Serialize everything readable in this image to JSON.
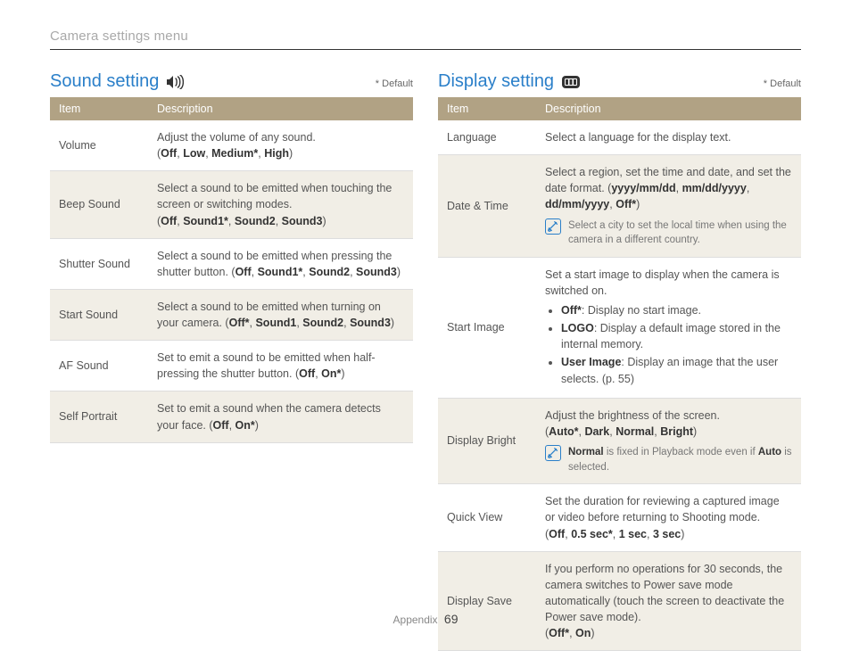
{
  "breadcrumb": "Camera settings menu",
  "default_note": "* Default",
  "sound": {
    "title": "Sound setting",
    "headers": {
      "item": "Item",
      "desc": "Description"
    },
    "rows": {
      "volume": {
        "item": "Volume",
        "desc_pre": "Adjust the volume of any sound.",
        "opts_open": "(",
        "o1": "Off",
        "c1": ", ",
        "o2": "Low",
        "c2": ", ",
        "o3": "Medium*",
        "c3": ", ",
        "o4": "High",
        "opts_close": ")"
      },
      "beep": {
        "item": "Beep Sound",
        "desc_pre": "Select a sound to be emitted when touching the screen or switching modes.",
        "opts_open": "(",
        "o1": "Off",
        "c1": ", ",
        "o2": "Sound1*",
        "c2": ", ",
        "o3": "Sound2",
        "c3": ", ",
        "o4": "Sound3",
        "opts_close": ")"
      },
      "shutter": {
        "item": "Shutter Sound",
        "desc_pre": "Select a sound to be emitted when pressing the shutter button. (",
        "o1": "Off",
        "c1": ", ",
        "o2": "Sound1*",
        "c2": ", ",
        "o3": "Sound2",
        "c3": ", ",
        "o4": "Sound3",
        "opts_close": ")"
      },
      "start": {
        "item": "Start Sound",
        "desc_pre": "Select a sound to be emitted when turning on your camera. (",
        "o1": "Off*",
        "c1": ", ",
        "o2": "Sound1",
        "c2": ", ",
        "o3": "Sound2",
        "c3": ", ",
        "o4": "Sound3",
        "opts_close": ")"
      },
      "af": {
        "item": "AF Sound",
        "desc_pre": "Set to emit a sound to be emitted when half-pressing the shutter button. (",
        "o1": "Off",
        "c1": ", ",
        "o2": "On*",
        "opts_close": ")"
      },
      "self": {
        "item": "Self Portrait",
        "desc_pre": "Set to emit a sound when the camera detects your face. (",
        "o1": "Off",
        "c1": ", ",
        "o2": "On*",
        "opts_close": ")"
      }
    }
  },
  "display": {
    "title": "Display setting",
    "headers": {
      "item": "Item",
      "desc": "Description"
    },
    "rows": {
      "language": {
        "item": "Language",
        "desc": "Select a language for the display text."
      },
      "datetime": {
        "item": "Date & Time",
        "desc_pre": "Select a region, set the time and date, and set the date format. (",
        "o1": "yyyy/mm/dd",
        "c1": ", ",
        "o2": "mm/dd/yyyy",
        "c2": ", ",
        "o3": "dd/mm/yyyy",
        "c3": ", ",
        "o4": "Off*",
        "opts_close": ")",
        "note": "Select a city to set the local time when using the camera in a different country."
      },
      "startimage": {
        "item": "Start Image",
        "intro": "Set a start image to display when the camera is switched on.",
        "b1_key": "Off*",
        "b1_rest": ": Display no start image.",
        "b2_key": "LOGO",
        "b2_rest": ": Display a default image stored in the internal memory.",
        "b3_key": "User Image",
        "b3_rest": ": Display an image that the user selects. (p. 55)"
      },
      "bright": {
        "item": "Display Bright",
        "desc_pre": "Adjust the brightness of the screen.",
        "opts_open": "(",
        "o1": "Auto*",
        "c1": ", ",
        "o2": "Dark",
        "c2": ", ",
        "o3": "Normal",
        "c3": ", ",
        "o4": "Bright",
        "opts_close": ")",
        "note_b": "Normal",
        "note_rest": " is fixed in Playback mode even if ",
        "note_b2": "Auto",
        "note_rest2": " is selected."
      },
      "quickview": {
        "item": "Quick View",
        "desc_pre": "Set the duration for reviewing a captured image or video before returning to Shooting mode.",
        "opts_open": "(",
        "o1": "Off",
        "c1": ", ",
        "o2": "0.5 sec*",
        "c2": ", ",
        "o3": "1 sec",
        "c3": ", ",
        "o4": "3 sec",
        "opts_close": ")"
      },
      "save": {
        "item": "Display Save",
        "desc_pre": "If you perform no operations for 30 seconds, the camera switches to Power save mode automatically (touch the screen to deactivate the Power save mode).",
        "opts_open": "(",
        "o1": "Off*",
        "c1": ", ",
        "o2": "On",
        "opts_close": ")"
      }
    }
  },
  "footer": {
    "section": "Appendix",
    "page": "69"
  }
}
